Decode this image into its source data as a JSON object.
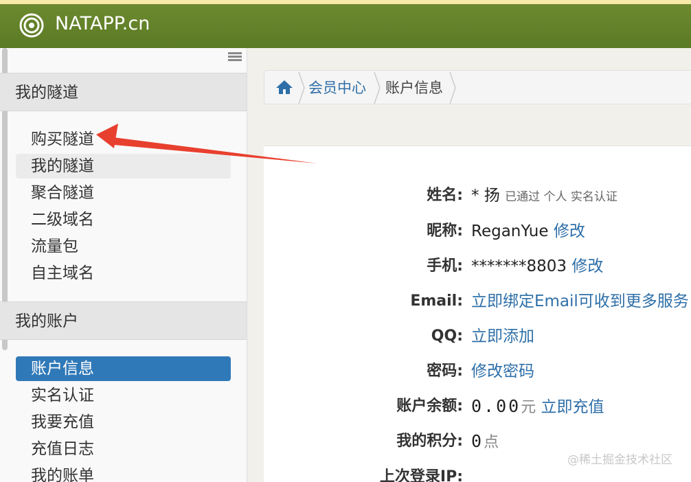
{
  "header": {
    "brand": "NATAPP.cn"
  },
  "sidebar": {
    "sections": [
      {
        "title": "我的隧道",
        "items": [
          "购买隧道",
          "我的隧道",
          "聚合隧道",
          "二级域名",
          "流量包",
          "自主域名"
        ]
      },
      {
        "title": "我的账户",
        "items": [
          "账户信息",
          "实名认证",
          "我要充值",
          "充值日志",
          "我的账单"
        ]
      }
    ]
  },
  "breadcrumb": {
    "home_icon": "home-icon",
    "links": [
      "会员中心"
    ],
    "current": "账户信息"
  },
  "account": {
    "name": {
      "label": "姓名:",
      "value": "* 扬",
      "status": "已通过 个人 实名认证"
    },
    "nickname": {
      "label": "昵称:",
      "value": "ReganYue",
      "action": "修改"
    },
    "phone": {
      "label": "手机:",
      "value": "*******8803",
      "action": "修改"
    },
    "email": {
      "label": "Email:",
      "action": "立即绑定Email可收到更多服务"
    },
    "qq": {
      "label": "QQ:",
      "action": "立即添加"
    },
    "password": {
      "label": "密码:",
      "action": "修改密码"
    },
    "balance": {
      "label": "账户余额:",
      "value": "0.00",
      "unit": "元",
      "action": "立即充值"
    },
    "points": {
      "label": "我的积分:",
      "value": "0",
      "unit": "点"
    },
    "last_login": {
      "label": "上次登录IP:"
    }
  },
  "watermark": "@稀土掘金技术社区",
  "colors": {
    "header": "#6c8a2f",
    "accent": "#3079b8",
    "link": "#2e6fa8",
    "arrow": "#e8402f"
  }
}
